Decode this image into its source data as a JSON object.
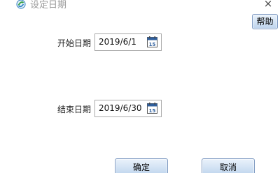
{
  "window": {
    "title": "设定日期",
    "close_glyph": "×",
    "app_icon": "app-logo-icon"
  },
  "help_button": {
    "label": "帮助"
  },
  "start_date": {
    "label": "开始日期",
    "value": "2019/6/1",
    "icon": "calendar-icon",
    "icon_text": "15"
  },
  "end_date": {
    "label": "结束日期",
    "value": "2019/6/30",
    "icon": "calendar-icon",
    "icon_text": "15"
  },
  "footer": {
    "ok_label": "确定",
    "cancel_label": "取消"
  },
  "colors": {
    "button_border": "#7d99c1",
    "button_fill": "#d3e3f4",
    "calendar_header": "#2f5f9e"
  }
}
